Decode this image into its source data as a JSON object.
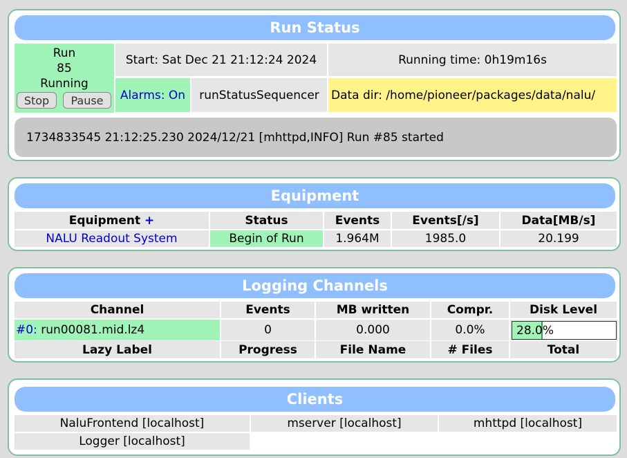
{
  "run_status": {
    "title": "Run Status",
    "run_label": "Run",
    "run_number": "85",
    "state": "Running",
    "stop_label": "Stop",
    "pause_label": "Pause",
    "start": "Start: Sat Dec 21 21:12:24 2024",
    "running_time": "Running time: 0h19m16s",
    "alarms": "Alarms: On",
    "sequencer": "runStatusSequencer",
    "data_dir": "Data dir: /home/pioneer/packages/data/nalu/",
    "message": "1734833545 21:12:25.230 2024/12/21 [mhttpd,INFO] Run #85 started"
  },
  "equipment": {
    "title": "Equipment",
    "headers": [
      "Equipment",
      "Status",
      "Events",
      "Events[/s]",
      "Data[MB/s]"
    ],
    "add_symbol": "+",
    "rows": [
      {
        "name": "NALU Readout System",
        "status": "Begin of Run",
        "events": "1.964M",
        "rate": "1985.0",
        "data": "20.199"
      }
    ]
  },
  "logging": {
    "title": "Logging Channels",
    "headers": [
      "Channel",
      "Events",
      "MB written",
      "Compr.",
      "Disk Level"
    ],
    "rows": [
      {
        "id": "#0:",
        "file": "run00081.mid.lz4",
        "events": "0",
        "mb": "0.000",
        "compr": "0.0%",
        "disk": "28.0%",
        "disk_fraction": 0.28
      }
    ],
    "lazy_headers": [
      "Lazy Label",
      "Progress",
      "File Name",
      "# Files",
      "Total"
    ]
  },
  "clients": {
    "title": "Clients",
    "items": [
      "NaluFrontend [localhost]",
      "mserver [localhost]",
      "mhttpd [localhost]",
      "Logger [localhost]"
    ]
  },
  "colors": {
    "header": "#8fbfff",
    "running": "#a0f4b8",
    "data_dir": "#fff38a",
    "panel_border": "#7fbf9f"
  }
}
